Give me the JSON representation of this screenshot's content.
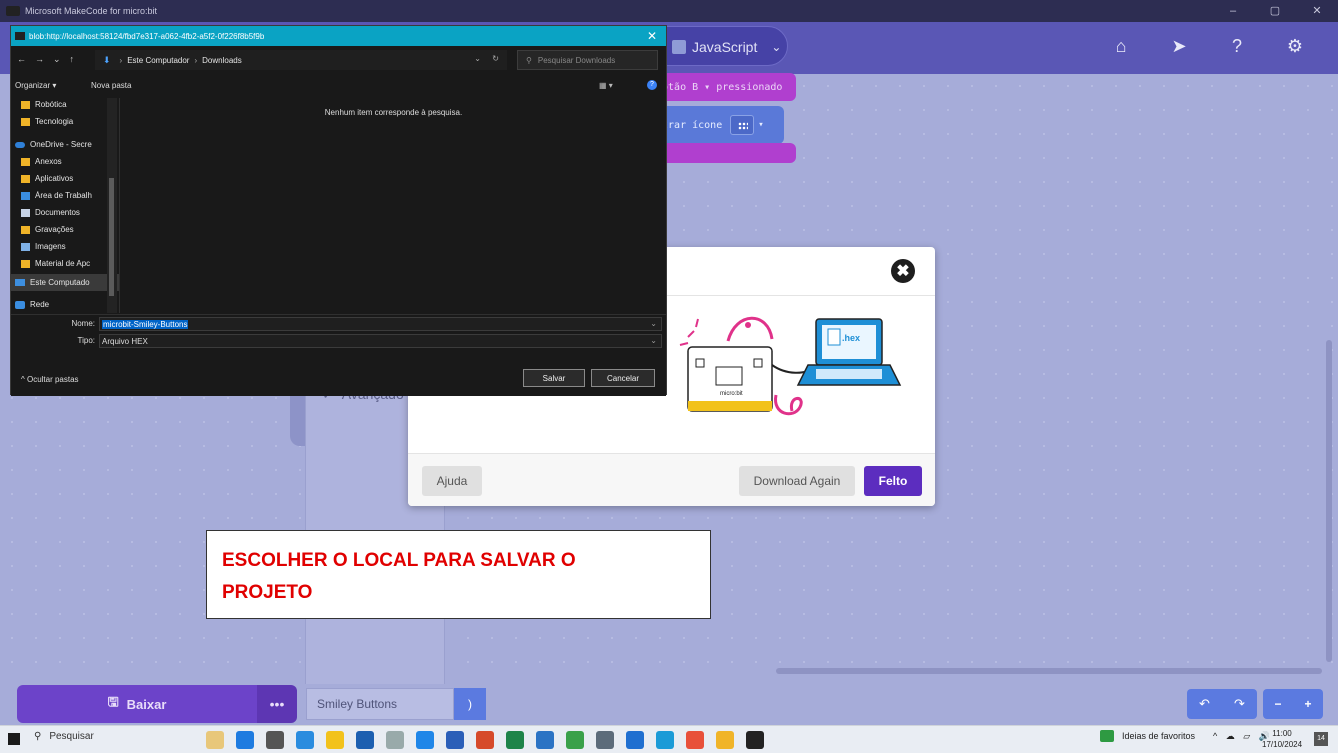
{
  "window": {
    "title": "Microsoft MakeCode for micro:bit",
    "controls": [
      "–",
      "▢",
      "✕"
    ]
  },
  "header": {
    "js_label": "JavaScript",
    "icons": [
      "home-icon",
      "share-icon",
      "help-icon",
      "settings-icon"
    ]
  },
  "blocks": {
    "b1": "botão B ▾ pressionado",
    "b2": "strar ícone",
    "b2_dropdown": "▾"
  },
  "toolbox": {
    "advanced": "Avançado"
  },
  "modal": {
    "close": "✖",
    "hex_label": ".hex",
    "board_label": "micro:bit",
    "help": "Ajuda",
    "again": "Download Again",
    "done": "Felto"
  },
  "save_dialog": {
    "title": "blob:http://localhost:58124/fbd7e317-a062-4fb2-a5f2-0f226f8b5f9b",
    "close": "✕",
    "nav": {
      "back": "←",
      "forward": "→",
      "recent": "⌄",
      "up": "↑"
    },
    "breadcrumb": [
      "Este Computador",
      "Downloads"
    ],
    "search_placeholder": "Pesquisar Downloads",
    "organize": "Organizar ▾",
    "new_folder": "Nova pasta",
    "view": "▦ ▾",
    "nav_items": [
      {
        "label": "Robótica",
        "icon": "folder"
      },
      {
        "label": "Tecnologia",
        "icon": "folder"
      },
      {
        "label": "OneDrive - Secre",
        "icon": "cloud"
      },
      {
        "label": "Anexos",
        "icon": "folder"
      },
      {
        "label": "Aplicativos",
        "icon": "folder"
      },
      {
        "label": "Área de Trabalh",
        "icon": "folder-blue"
      },
      {
        "label": "Documentos",
        "icon": "doc"
      },
      {
        "label": "Gravações",
        "icon": "folder"
      },
      {
        "label": "Imagens",
        "icon": "img"
      },
      {
        "label": "Material de Apc",
        "icon": "folder"
      },
      {
        "label": "Este Computado",
        "icon": "pc"
      },
      {
        "label": "Rede",
        "icon": "net"
      }
    ],
    "empty_message": "Nenhum item corresponde à pesquisa.",
    "name_label": "Nome:",
    "name_value": "microbit-Smiley-Buttons",
    "type_label": "Tipo:",
    "type_value": "Arquivo HEX",
    "hide_folders": "^ Ocultar pastas",
    "save": "Salvar",
    "cancel": "Cancelar"
  },
  "bottom": {
    "download": "Baixar",
    "more": "•••",
    "project_name": "Smiley Buttons",
    "undo": "↶",
    "redo": "↷",
    "zoom_out": "−",
    "zoom_in": "+"
  },
  "annotation": {
    "line1": "ESCOLHER O LOCAL PARA SALVAR O",
    "line2": "PROJETO"
  },
  "taskbar": {
    "search": "Pesquisar",
    "favorites": "Ideias de favoritos",
    "time": "11:00",
    "date": "17/10/2024",
    "notifications": "14",
    "app_colors": [
      "#e8c77a",
      "#1e7be0",
      "#555",
      "#2a8cdf",
      "#f2c21b",
      "#1c5fb0",
      "#9aa",
      "#1f86e8",
      "#2b5fb8",
      "#d64a2a",
      "#1e8449",
      "#2b73c4",
      "#3aa14a",
      "#5c6b7a",
      "#1f6fd0",
      "#1b9bd7",
      "#e8503a",
      "#f0b428",
      "#222"
    ]
  }
}
